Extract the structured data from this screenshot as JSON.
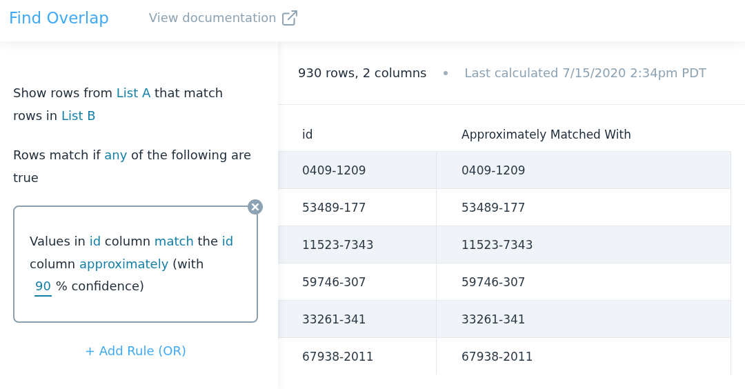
{
  "header": {
    "title": "Find Overlap",
    "doc_link": "View documentation"
  },
  "sidebar": {
    "paragraphs": [
      [
        {
          "kind": "text",
          "text": "Show rows from"
        },
        {
          "kind": "link",
          "text": "List A"
        },
        {
          "kind": "text",
          "text": "that match rows in"
        },
        {
          "kind": "link",
          "text": "List B"
        }
      ],
      [
        {
          "kind": "text",
          "text": "Rows match if"
        },
        {
          "kind": "link",
          "text": "any"
        },
        {
          "kind": "text",
          "text": "of the following are true"
        }
      ]
    ],
    "rules": [
      {
        "segments": [
          {
            "kind": "text",
            "text": "Values in"
          },
          {
            "kind": "link",
            "text": "id"
          },
          {
            "kind": "text",
            "text": "column"
          },
          {
            "kind": "link",
            "text": "match"
          },
          {
            "kind": "text",
            "text": "the"
          },
          {
            "kind": "link",
            "text": "id"
          },
          {
            "kind": "text",
            "text": "column"
          },
          {
            "kind": "link",
            "text": "approximately"
          },
          {
            "kind": "text",
            "text": "(with"
          },
          {
            "kind": "field",
            "text": "90"
          },
          {
            "kind": "text",
            "text": "% confidence)"
          }
        ]
      }
    ],
    "add_rule": "+ Add Rule (OR)"
  },
  "summary": {
    "size": "930 rows, 2 columns",
    "last_calculated": "Last calculated 7/15/2020 2:34pm PDT"
  },
  "table": {
    "columns": [
      "id",
      "Approximately Matched With"
    ],
    "rows": [
      [
        "0409-1209",
        "0409-1209"
      ],
      [
        "53489-177",
        "53489-177"
      ],
      [
        "11523-7343",
        "11523-7343"
      ],
      [
        "59746-307",
        "59746-307"
      ],
      [
        "33261-341",
        "33261-341"
      ],
      [
        "67938-2011",
        "67938-2011"
      ]
    ]
  }
}
